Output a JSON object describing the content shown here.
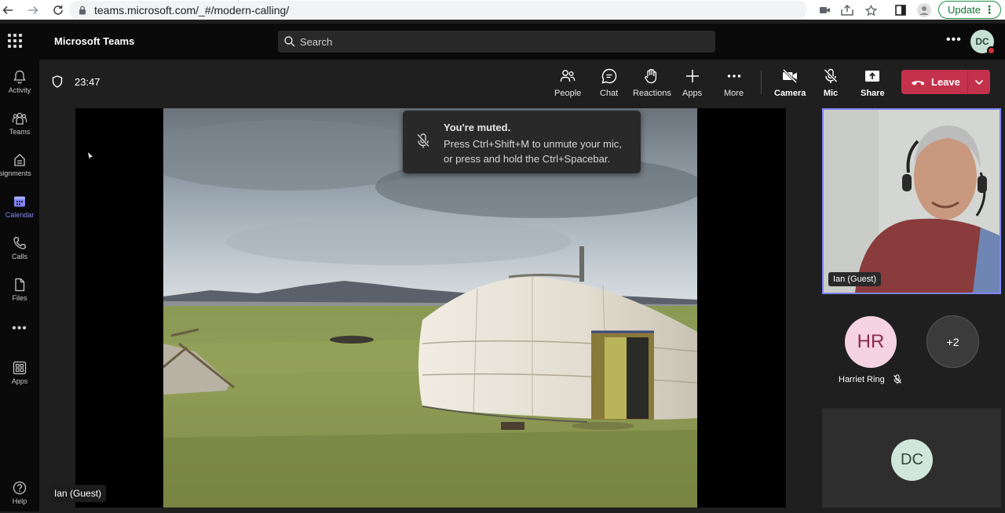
{
  "browser": {
    "url": "teams.microsoft.com/_#/modern-calling/",
    "update_label": "Update"
  },
  "header": {
    "app_title": "Microsoft Teams",
    "search_placeholder": "Search",
    "avatar_initials": "DC"
  },
  "rail": {
    "items": [
      {
        "label": "Activity",
        "icon": "bell-icon"
      },
      {
        "label": "Teams",
        "icon": "teams-icon"
      },
      {
        "label": "Assignments",
        "icon": "assignments-icon"
      },
      {
        "label": "Calendar",
        "icon": "calendar-icon",
        "active": true
      },
      {
        "label": "Calls",
        "icon": "phone-icon"
      },
      {
        "label": "Files",
        "icon": "file-icon"
      },
      {
        "label": "Apps",
        "icon": "apps-icon"
      },
      {
        "label": "Help",
        "icon": "help-icon"
      }
    ]
  },
  "meeting": {
    "timer": "23:47",
    "tools": {
      "people": "People",
      "chat": "Chat",
      "reactions": "Reactions",
      "apps": "Apps",
      "more": "More",
      "camera": "Camera",
      "mic": "Mic",
      "share": "Share"
    },
    "leave_label": "Leave"
  },
  "toast": {
    "title": "You're muted.",
    "message": "Press Ctrl+Shift+M to unmute your mic, or press and hold the Ctrl+Spacebar."
  },
  "stage": {
    "presenter_name": "Ian (Guest)"
  },
  "participants": {
    "video_name": "Ian (Guest)",
    "hr_initials": "HR",
    "hr_name": "Harriet Ring",
    "more_count": "+2",
    "self_initials": "DC"
  },
  "colors": {
    "accent": "#7f85f5",
    "leave": "#c4314b",
    "presence_busy": "#d13438"
  }
}
